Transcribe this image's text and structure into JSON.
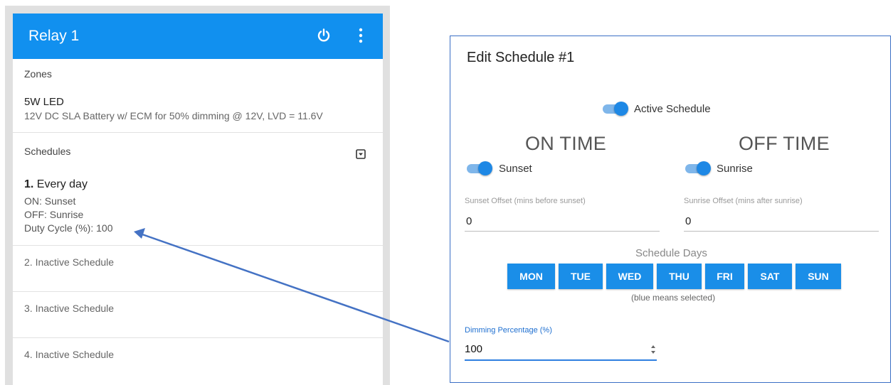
{
  "relay": {
    "title": "Relay 1",
    "zones_title": "Zones",
    "zone": {
      "name": "5W LED",
      "description": "12V DC SLA Battery w/ ECM for 50% dimming @ 12V, LVD = 11.6V"
    },
    "schedules_title": "Schedules",
    "schedule1": {
      "number": "1.",
      "name": "Every day",
      "on": "ON:  Sunset",
      "off": "OFF: Sunrise",
      "duty": "Duty Cycle (%): 100"
    },
    "inactive": [
      "2. Inactive Schedule",
      "3. Inactive Schedule",
      "4. Inactive Schedule"
    ]
  },
  "edit": {
    "title": "Edit Schedule #1",
    "active_label": "Active Schedule",
    "on_heading": "ON TIME",
    "off_heading": "OFF TIME",
    "on_toggle_label": "Sunset",
    "off_toggle_label": "Sunrise",
    "on_offset_label": "Sunset Offset (mins before sunset)",
    "on_offset_value": "0",
    "off_offset_label": "Sunrise Offset (mins after sunrise)",
    "off_offset_value": "0",
    "days_title": "Schedule Days",
    "days": [
      "MON",
      "TUE",
      "WED",
      "THU",
      "FRI",
      "SAT",
      "SUN"
    ],
    "days_note": "(blue means selected)",
    "dimming_label": "Dimming Percentage (%)",
    "dimming_value": "100"
  },
  "colors": {
    "header_blue": "#1190ef",
    "accent_blue": "#1a8ee8",
    "arrow_blue": "#4472c4"
  },
  "icons": {
    "power": "power-icon",
    "menu": "kebab-menu-icon",
    "expand": "dropdown-icon"
  }
}
